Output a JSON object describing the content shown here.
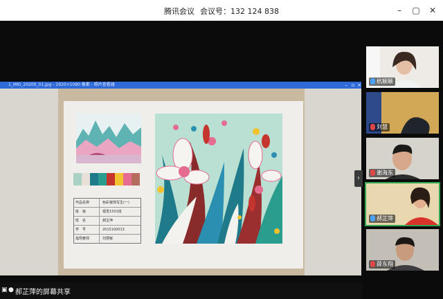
{
  "window": {
    "app_name": "腾讯会议",
    "meeting_label": "会议号：132 124 838",
    "controls": [
      "–",
      "▢",
      "✕"
    ]
  },
  "shared_screen": {
    "viewer_title": "1_IMG_20200_01.jpg - 1920×1080 像素 - 照片查看器",
    "share_status": "郝芷萍的屏幕共享",
    "artwork": {
      "info_rows": [
        {
          "field": "作品名称",
          "value": "色彩装饰写生(一)"
        },
        {
          "field": "班　级",
          "value": "视觉1501班"
        },
        {
          "field": "姓　名",
          "value": "郝芷萍"
        },
        {
          "field": "学　号",
          "value": "2015100013"
        },
        {
          "field": "指导教师",
          "value": "刘慧敏"
        }
      ],
      "palette": [
        "#a9d2c4",
        "#e6e0d6",
        "#1f7b8a",
        "#2a9d8f",
        "#c4352e",
        "#f2c230",
        "#e56b91",
        "#b46c5c"
      ]
    }
  },
  "participants": [
    {
      "name": "杭颖颖",
      "muted": false
    },
    {
      "name": "刘慧",
      "muted": true
    },
    {
      "name": "谢海东",
      "muted": true
    },
    {
      "name": "郝芷萍",
      "muted": false,
      "speaking": true
    },
    {
      "name": "薛东翔",
      "muted": true
    }
  ],
  "colors": {
    "accent": "#2f6ad9",
    "active_outline": "#2fa84f",
    "background": "#0b0b0b"
  }
}
